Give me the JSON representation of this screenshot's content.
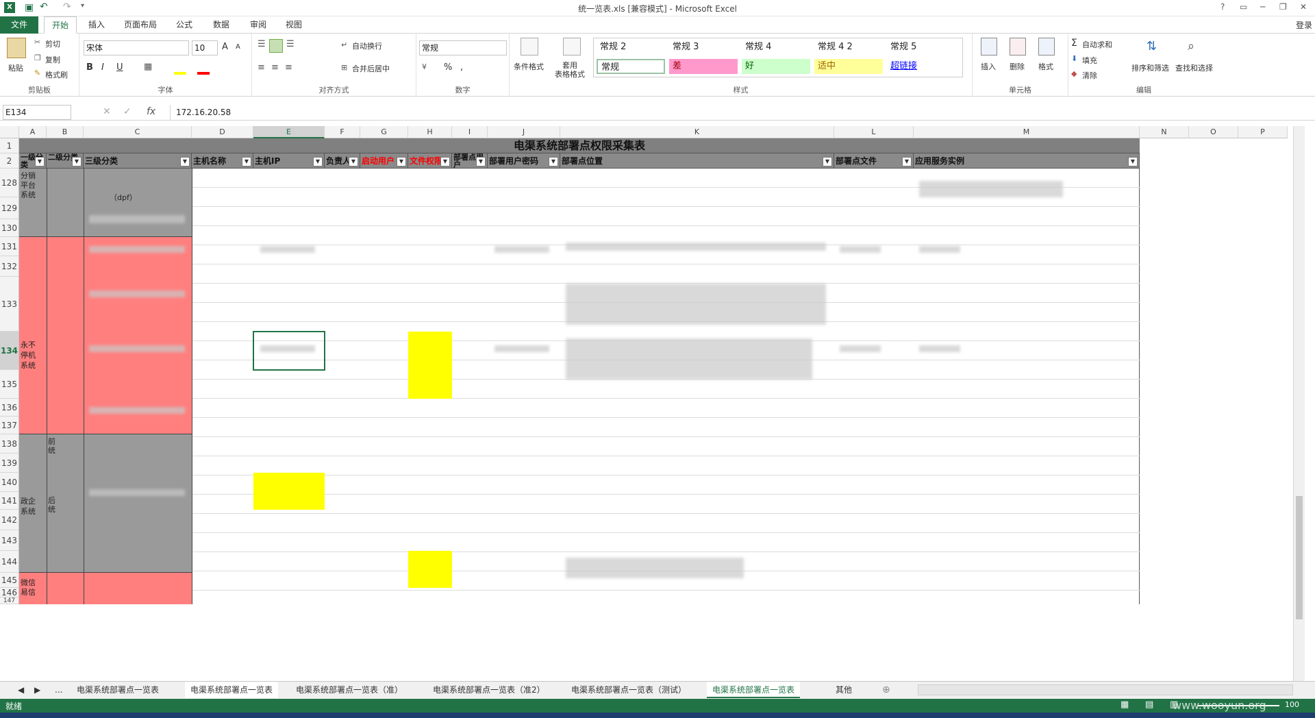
{
  "window": {
    "title": "统一览表.xls  [兼容模式] - Microsoft Excel",
    "login": "登录",
    "controls": [
      "?",
      "▭",
      "─",
      "❐",
      "✕"
    ]
  },
  "menu": {
    "tabs": [
      "文件",
      "开始",
      "插入",
      "页面布局",
      "公式",
      "数据",
      "审阅",
      "视图"
    ]
  },
  "ribbon": {
    "clipboard": {
      "paste": "粘贴",
      "cut": "剪切",
      "copy": "复制",
      "format_painter": "格式刷",
      "label": "剪贴板"
    },
    "font": {
      "name": "宋体",
      "size": "10",
      "bold": "B",
      "italic": "I",
      "underline": "U",
      "grow": "A",
      "shrink": "A",
      "label": "字体"
    },
    "alignment": {
      "wrap": "自动换行",
      "merge": "合并后居中",
      "label": "对齐方式"
    },
    "number": {
      "format": "常规",
      "percent": "%",
      "comma": ",",
      "label": "数字"
    },
    "styles": {
      "conditional": "条件格式",
      "table": "套用\n表格格式",
      "cells": [
        {
          "text": "常规 2",
          "color": "#ffffff",
          "fg": "#222222"
        },
        {
          "text": "常规 3",
          "color": "#ffffff",
          "fg": "#222222"
        },
        {
          "text": "常规 4",
          "color": "#ffffff",
          "fg": "#222222"
        },
        {
          "text": "常规 4 2",
          "color": "#ffffff",
          "fg": "#222222"
        },
        {
          "text": "常规 5",
          "color": "#ffffff",
          "fg": "#222222"
        },
        {
          "text": "常规",
          "color": "#ffffff",
          "fg": "#222222"
        },
        {
          "text": "差",
          "color": "#ff99cc",
          "fg": "#9c0006"
        },
        {
          "text": "好",
          "color": "#ccffcc",
          "fg": "#006100"
        },
        {
          "text": "适中",
          "color": "#ffff99",
          "fg": "#9c6500"
        },
        {
          "text": "超链接",
          "color": "#ffffff",
          "fg": "#0000ff"
        }
      ],
      "label": "样式"
    },
    "cells": {
      "insert": "插入",
      "delete": "删除",
      "format": "格式",
      "label": "单元格"
    },
    "editing": {
      "autosum": "自动求和",
      "fill": "填充",
      "clear": "清除",
      "sort": "排序和筛选",
      "find": "查找和选择",
      "label": "编辑"
    }
  },
  "formula_bar": {
    "name_box": "E134",
    "fx": "fx",
    "value": "172.16.20.58"
  },
  "columns": [
    "A",
    "B",
    "C",
    "D",
    "E",
    "F",
    "G",
    "H",
    "I",
    "J",
    "K",
    "L",
    "M",
    "N",
    "O",
    "P"
  ],
  "sheet": {
    "title": "电渠系统部署点权限采集表",
    "headers": [
      "一级分类",
      "二级分类",
      "三级分类",
      "主机名称",
      "主机IP",
      "负责人",
      "启动用户",
      "文件权限",
      "部署点用户",
      "部署用户密码",
      "部署点位置",
      "部署点文件",
      "应用服务实例"
    ],
    "row_numbers": [
      "1",
      "2",
      "128",
      "129",
      "130",
      "131",
      "132",
      "133",
      "134",
      "135",
      "136",
      "137",
      "138",
      "139",
      "140",
      "141",
      "142",
      "143",
      "144",
      "145",
      "146",
      "147"
    ],
    "cell_text": {
      "c128": "（dpf）",
      "a_pingtai": "分销\n平台\n系统",
      "a_yongbu": "永不\n停机\n系统",
      "a_zhengqi": "政企\n系统",
      "a_weixin": "微信\n易信",
      "b_qian": "前\n统",
      "b_hou": "后\n统"
    }
  },
  "sheet_tabs": {
    "nav": [
      "◀",
      "▶",
      "..."
    ],
    "tabs": [
      "电渠系统部署点一览表",
      "电渠系统部署点一览表",
      "电渠系统部署点一览表（准）",
      "电渠系统部署点一览表（准2）",
      "电渠系统部署点一览表（测试）",
      "电渠系统部署点一览表",
      "其他"
    ],
    "add": "⊕"
  },
  "status": {
    "ready": "就绪",
    "zoom": "100"
  },
  "watermark": "www.wooyun.org",
  "colors": {
    "accent": "#217346",
    "red_fill": "#ff7f7f",
    "gray_fill": "#9a9a9a",
    "yellow_fill": "#ffff00"
  }
}
